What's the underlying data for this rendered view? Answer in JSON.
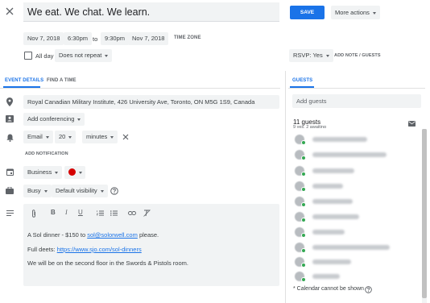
{
  "header": {
    "title": "We eat. We chat. We learn.",
    "save_label": "SAVE",
    "more_actions_label": "More actions"
  },
  "datetime": {
    "start_date": "Nov 7, 2018",
    "start_time": "6:30pm",
    "to_label": "to",
    "end_time": "9:30pm",
    "end_date": "Nov 7, 2018",
    "time_zone_label": "TIME ZONE",
    "all_day_label": "All day",
    "repeat_value": "Does not repeat"
  },
  "rsvp": {
    "value": "RSVP: Yes",
    "add_note_label": "ADD NOTE / GUESTS"
  },
  "tabs": [
    {
      "label": "EVENT DETAILS",
      "active": true
    },
    {
      "label": "FIND A TIME",
      "active": false
    }
  ],
  "details": {
    "location": "Royal Canadian Military Institute, 426 University Ave, Toronto, ON M5G 1S9, Canada",
    "conferencing_label": "Add conferencing",
    "notification": {
      "method": "Email",
      "amount": "20",
      "unit": "minutes"
    },
    "add_notification_label": "ADD NOTIFICATION",
    "calendar_value": "Business",
    "calendar_color": "#d50000",
    "busy_value": "Busy",
    "visibility_value": "Default visibility"
  },
  "description": {
    "line1_prefix": "A Sol dinner - $150 to ",
    "line1_link": "sol@solorwell.com",
    "line1_suffix": " please.",
    "line2_prefix": "Full deets: ",
    "line2_link": "https://www.sjo.com/sol-dinners",
    "line3": "We will be on the second floor in the Swords & Pistols room."
  },
  "guests": {
    "tab_label": "GUESTS",
    "add_placeholder": "Add guests",
    "count_label": "11 guests",
    "summary": "9 yes, 2 awaiting",
    "calendar_note": "* Calendar cannot be shown"
  },
  "colors": {
    "accent": "#1a73e8",
    "guest_check": "#34a853"
  }
}
